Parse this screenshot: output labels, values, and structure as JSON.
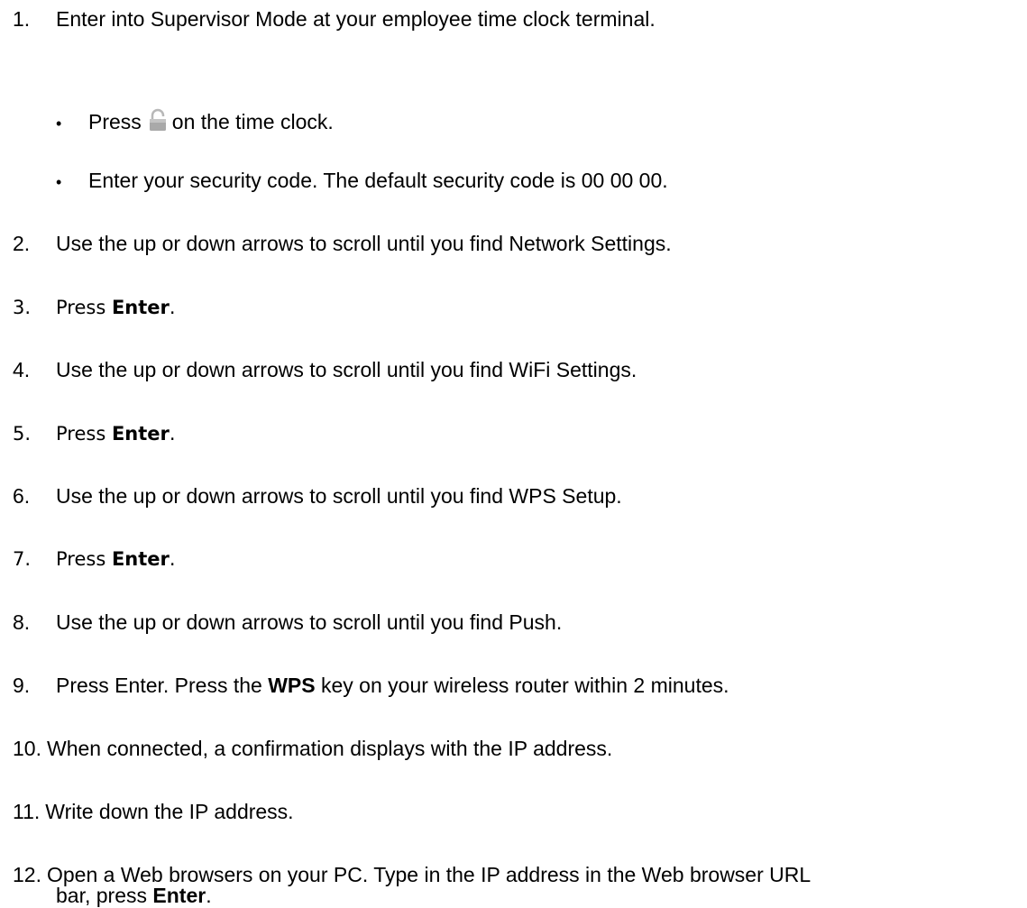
{
  "steps": [
    {
      "num": "1.",
      "text": "Enter into Supervisor Mode at your employee time clock terminal."
    },
    {
      "num": "2.",
      "text": "Use the up or down arrows to scroll until you find Network Settings."
    },
    {
      "num": "3.",
      "pre": "Press ",
      "bold": "Enter",
      "post": "."
    },
    {
      "num": "4.",
      "text": "Use the up or down arrows to scroll until you find WiFi Settings."
    },
    {
      "num": "5.",
      "pre": "Press ",
      "bold": "Enter",
      "post": "."
    },
    {
      "num": "6.",
      "text": "Use the up or down arrows to scroll until you find WPS Setup."
    },
    {
      "num": "7.",
      "pre": "Press ",
      "bold": "Enter",
      "post": "."
    },
    {
      "num": "8.",
      "text": "Use the up or down arrows to scroll until you find Push."
    },
    {
      "num": "9.",
      "pre": "Press Enter. Press the ",
      "bold": "WPS",
      "post": " key on your wireless router within 2 minutes."
    },
    {
      "num": "10.",
      "text": "When connected, a confirmation displays with the IP address."
    },
    {
      "num": "11.",
      "text": "Write down the IP address."
    },
    {
      "num": "12.",
      "line1": "Open a Web browsers on your PC. Type in the IP address in the Web browser URL",
      "pre2": "bar,  press ",
      "bold": "Enter",
      "post": "."
    }
  ],
  "substeps": [
    {
      "bullet": "•",
      "pre": "Press",
      "icon": "lock-icon",
      "post": "on the time clock."
    },
    {
      "bullet": "•",
      "text": "Enter your security code. The default security code is 00 00 00."
    }
  ],
  "colors": {
    "text": "#000000",
    "background": "#ffffff",
    "icon": "#a9a9a9"
  }
}
